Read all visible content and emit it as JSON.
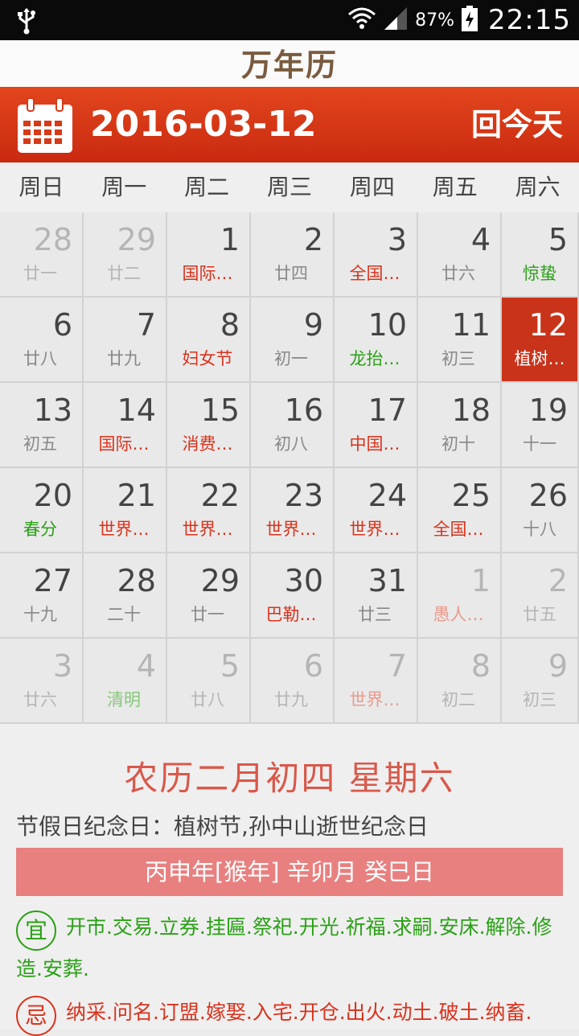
{
  "status_bar": {
    "battery": "87%",
    "time": "22:15"
  },
  "app": {
    "title": "万年历"
  },
  "header": {
    "date": "2016-03-12",
    "today_button": "回今天",
    "accent_color": "#d63a16"
  },
  "weekdays": [
    "周日",
    "周一",
    "周二",
    "周三",
    "周四",
    "周五",
    "周六"
  ],
  "calendar": {
    "weeks": [
      [
        {
          "day": "28",
          "sub": "廿一",
          "type": "normal",
          "dim": true
        },
        {
          "day": "29",
          "sub": "廿二",
          "type": "normal",
          "dim": true
        },
        {
          "day": "1",
          "sub": "国际…",
          "type": "red",
          "dim": false
        },
        {
          "day": "2",
          "sub": "廿四",
          "type": "normal",
          "dim": false
        },
        {
          "day": "3",
          "sub": "全国…",
          "type": "red",
          "dim": false
        },
        {
          "day": "4",
          "sub": "廿六",
          "type": "normal",
          "dim": false
        },
        {
          "day": "5",
          "sub": "惊蛰",
          "type": "green",
          "dim": false
        }
      ],
      [
        {
          "day": "6",
          "sub": "廿八",
          "type": "normal",
          "dim": false
        },
        {
          "day": "7",
          "sub": "廿九",
          "type": "normal",
          "dim": false
        },
        {
          "day": "8",
          "sub": "妇女节",
          "type": "red",
          "dim": false
        },
        {
          "day": "9",
          "sub": "初一",
          "type": "normal",
          "dim": false
        },
        {
          "day": "10",
          "sub": "龙抬…",
          "type": "green",
          "dim": false
        },
        {
          "day": "11",
          "sub": "初三",
          "type": "normal",
          "dim": false
        },
        {
          "day": "12",
          "sub": "植树…",
          "type": "red",
          "dim": false,
          "selected": true
        }
      ],
      [
        {
          "day": "13",
          "sub": "初五",
          "type": "normal",
          "dim": false
        },
        {
          "day": "14",
          "sub": "国际…",
          "type": "red",
          "dim": false
        },
        {
          "day": "15",
          "sub": "消费…",
          "type": "red",
          "dim": false
        },
        {
          "day": "16",
          "sub": "初八",
          "type": "normal",
          "dim": false
        },
        {
          "day": "17",
          "sub": "中国…",
          "type": "red",
          "dim": false
        },
        {
          "day": "18",
          "sub": "初十",
          "type": "normal",
          "dim": false
        },
        {
          "day": "19",
          "sub": "十一",
          "type": "normal",
          "dim": false
        }
      ],
      [
        {
          "day": "20",
          "sub": "春分",
          "type": "green",
          "dim": false
        },
        {
          "day": "21",
          "sub": "世界…",
          "type": "red",
          "dim": false
        },
        {
          "day": "22",
          "sub": "世界…",
          "type": "red",
          "dim": false
        },
        {
          "day": "23",
          "sub": "世界…",
          "type": "red",
          "dim": false
        },
        {
          "day": "24",
          "sub": "世界…",
          "type": "red",
          "dim": false
        },
        {
          "day": "25",
          "sub": "全国…",
          "type": "red",
          "dim": false
        },
        {
          "day": "26",
          "sub": "十八",
          "type": "normal",
          "dim": false
        }
      ],
      [
        {
          "day": "27",
          "sub": "十九",
          "type": "normal",
          "dim": false
        },
        {
          "day": "28",
          "sub": "二十",
          "type": "normal",
          "dim": false
        },
        {
          "day": "29",
          "sub": "廿一",
          "type": "normal",
          "dim": false
        },
        {
          "day": "30",
          "sub": "巴勒…",
          "type": "red",
          "dim": false
        },
        {
          "day": "31",
          "sub": "廿三",
          "type": "normal",
          "dim": false
        },
        {
          "day": "1",
          "sub": "愚人…",
          "type": "red",
          "dim": true
        },
        {
          "day": "2",
          "sub": "廿五",
          "type": "normal",
          "dim": true
        }
      ],
      [
        {
          "day": "3",
          "sub": "廿六",
          "type": "normal",
          "dim": true
        },
        {
          "day": "4",
          "sub": "清明",
          "type": "green",
          "dim": true
        },
        {
          "day": "5",
          "sub": "廿八",
          "type": "normal",
          "dim": true
        },
        {
          "day": "6",
          "sub": "廿九",
          "type": "normal",
          "dim": true
        },
        {
          "day": "7",
          "sub": "世界…",
          "type": "red",
          "dim": true
        },
        {
          "day": "8",
          "sub": "初二",
          "type": "normal",
          "dim": true
        },
        {
          "day": "9",
          "sub": "初三",
          "type": "normal",
          "dim": true
        }
      ]
    ]
  },
  "details": {
    "lunar": "农历二月初四 星期六",
    "festivals": "节假日纪念日：植树节,孙中山逝世纪念日",
    "ganzhi": "丙申年[猴年] 辛卯月 癸巳日",
    "yi_label": "宜",
    "yi": "开市.交易.立券.挂匾.祭祀.开光.祈福.求嗣.安床.解除.修造.安葬.",
    "ji_label": "忌",
    "ji": "纳采.问名.订盟.嫁娶.入宅.开仓.出火.动土.破土.纳畜."
  }
}
